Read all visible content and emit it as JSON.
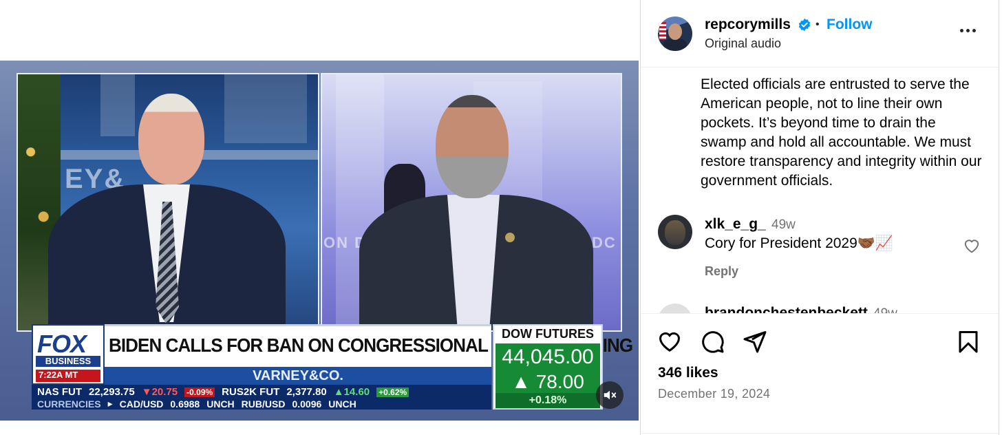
{
  "video": {
    "bg_letters_left": "EY&",
    "bg_letters_right_1": "ON D",
    "bg_letters_right_2": "N DC",
    "logo_fox": "FOX",
    "logo_business": "BUSINESS",
    "logo_time": "7:22A MT",
    "headline": "BIDEN CALLS FOR BAN ON CONGRESSIONAL STOCK TRADING",
    "show_name": "VARNEY&CO.",
    "ticker_row1": [
      {
        "label": "NAS FUT",
        "value": "22,293.75",
        "change": "20.75",
        "pct": "-0.09%",
        "dir": "down"
      },
      {
        "label": "RUS2K FUT",
        "value": "2,377.80",
        "change": "14.60",
        "pct": "+0.62%",
        "dir": "up"
      }
    ],
    "ticker_row2": [
      "CURRENCIES",
      "CAD/USD",
      "0.6988",
      "UNCH",
      "RUB/USD",
      "0.0096",
      "UNCH"
    ],
    "dow_label": "DOW FUTURES",
    "dow_value": "44,045.00",
    "dow_change": "78.00",
    "dow_pct": "+0.18%"
  },
  "post": {
    "author": "repcorymills",
    "separator": "•",
    "follow_label": "Follow",
    "audio": "Original audio",
    "caption": "Elected officials are entrusted to serve the American people, not to line their own pockets. It’s beyond time to drain the swamp and hold all accountable. We must restore transparency and integrity within our government officials.",
    "comments": [
      {
        "user": "xlk_e_g_",
        "time": "49w",
        "text": "Cory for President 2029🤝🏾📈",
        "reply_label": "Reply"
      },
      {
        "user": "brandonchestenbeckett",
        "time": "49w",
        "text": "",
        "reply_label": ""
      }
    ],
    "likes": "346 likes",
    "date": "December 19, 2024"
  },
  "icons": {
    "more": "more-options-icon",
    "verified": "verified-badge-icon",
    "like": "heart-icon",
    "comment": "comment-bubble-icon",
    "share": "paper-plane-icon",
    "save": "bookmark-icon",
    "mute": "speaker-muted-icon"
  },
  "colors": {
    "link": "#0095f6",
    "secondary_text": "#737373",
    "fox_blue": "#1b3f8f",
    "fox_red": "#c4161c",
    "market_green": "#168a34"
  }
}
